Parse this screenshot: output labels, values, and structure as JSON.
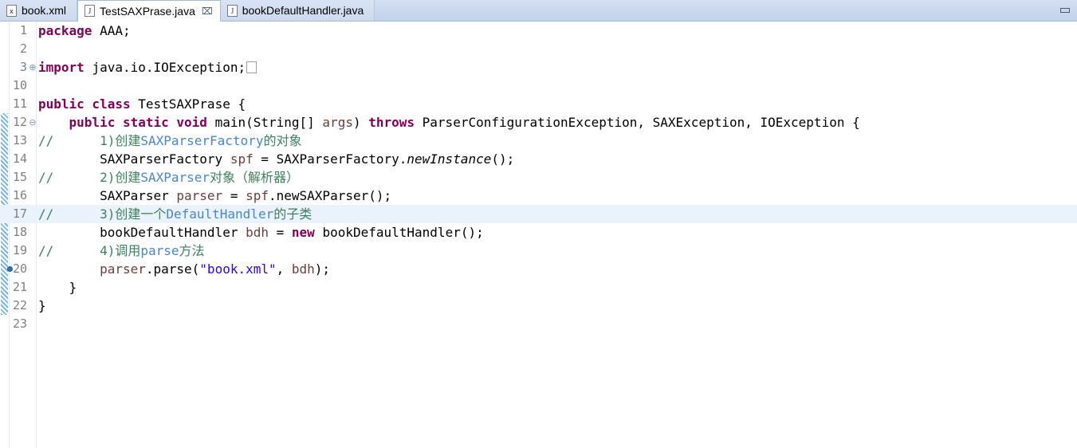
{
  "window": {
    "minimize_label": "Minimize"
  },
  "tabs": [
    {
      "label": "book.xml",
      "icon": "xml-file-icon",
      "active": false,
      "closable": false
    },
    {
      "label": "TestSAXPrase.java",
      "icon": "java-file-icon",
      "active": true,
      "closable": true,
      "close_glyph": "⌧"
    },
    {
      "label": "bookDefaultHandler.java",
      "icon": "java-file-icon",
      "active": false,
      "closable": false
    }
  ],
  "editor": {
    "file": "TestSAXPrase.java",
    "current_line": 17,
    "marker_line": 20,
    "lines": [
      {
        "num": "1",
        "fold": "",
        "segments": [
          {
            "t": "package ",
            "c": "kw"
          },
          {
            "t": "AAA;",
            "c": "plain"
          }
        ]
      },
      {
        "num": "2",
        "fold": "",
        "segments": []
      },
      {
        "num": "3",
        "fold": "+",
        "segments": [
          {
            "t": "import ",
            "c": "kw"
          },
          {
            "t": "java.io.IOException;",
            "c": "plain"
          },
          {
            "t": "□",
            "c": "foldbox"
          }
        ]
      },
      {
        "num": "10",
        "fold": "",
        "segments": []
      },
      {
        "num": "11",
        "fold": "",
        "segments": [
          {
            "t": "public class ",
            "c": "kw"
          },
          {
            "t": "TestSAXPrase {",
            "c": "plain"
          }
        ]
      },
      {
        "num": "12",
        "fold": "-",
        "segments": [
          {
            "t": "    ",
            "c": "plain"
          },
          {
            "t": "public static void ",
            "c": "kw"
          },
          {
            "t": "main(String[] ",
            "c": "plain"
          },
          {
            "t": "args",
            "c": "local"
          },
          {
            "t": ") ",
            "c": "plain"
          },
          {
            "t": "throws ",
            "c": "kw"
          },
          {
            "t": "ParserConfigurationException, SAXException, IOException {",
            "c": "plain"
          }
        ]
      },
      {
        "num": "13",
        "fold": "",
        "segments": [
          {
            "t": "//",
            "c": "cmt"
          },
          {
            "t": "      1)创建",
            "c": "cmt"
          },
          {
            "t": "SAXParserFactory",
            "c": "hl-blue"
          },
          {
            "t": "的对象",
            "c": "cmt"
          }
        ]
      },
      {
        "num": "14",
        "fold": "",
        "segments": [
          {
            "t": "        SAXParserFactory ",
            "c": "plain"
          },
          {
            "t": "spf",
            "c": "local"
          },
          {
            "t": " = SAXParserFactory.",
            "c": "plain"
          },
          {
            "t": "newInstance",
            "c": "stat"
          },
          {
            "t": "();",
            "c": "plain"
          }
        ]
      },
      {
        "num": "15",
        "fold": "",
        "segments": [
          {
            "t": "//",
            "c": "cmt"
          },
          {
            "t": "      2)创建",
            "c": "cmt"
          },
          {
            "t": "SAXParser",
            "c": "hl-blue"
          },
          {
            "t": "对象（解析器）",
            "c": "cmt"
          }
        ]
      },
      {
        "num": "16",
        "fold": "",
        "segments": [
          {
            "t": "        SAXParser ",
            "c": "plain"
          },
          {
            "t": "parser",
            "c": "local"
          },
          {
            "t": " = ",
            "c": "plain"
          },
          {
            "t": "spf",
            "c": "local"
          },
          {
            "t": ".newSAXParser();",
            "c": "plain"
          }
        ]
      },
      {
        "num": "17",
        "fold": "",
        "segments": [
          {
            "t": "//",
            "c": "cmt"
          },
          {
            "t": "      3)创建一个",
            "c": "cmt"
          },
          {
            "t": "DefaultHandler",
            "c": "hl-blue"
          },
          {
            "t": "的子类",
            "c": "cmt"
          }
        ]
      },
      {
        "num": "18",
        "fold": "",
        "segments": [
          {
            "t": "        bookDefaultHandler ",
            "c": "plain"
          },
          {
            "t": "bdh",
            "c": "local"
          },
          {
            "t": " = ",
            "c": "plain"
          },
          {
            "t": "new ",
            "c": "kw"
          },
          {
            "t": "bookDefaultHandler();",
            "c": "plain"
          }
        ]
      },
      {
        "num": "19",
        "fold": "",
        "segments": [
          {
            "t": "//",
            "c": "cmt"
          },
          {
            "t": "      4)调用",
            "c": "cmt"
          },
          {
            "t": "parse",
            "c": "hl-blue"
          },
          {
            "t": "方法",
            "c": "cmt"
          }
        ]
      },
      {
        "num": "20",
        "fold": "",
        "segments": [
          {
            "t": "        ",
            "c": "plain"
          },
          {
            "t": "parser",
            "c": "local"
          },
          {
            "t": ".parse(",
            "c": "plain"
          },
          {
            "t": "\"book.xml\"",
            "c": "str"
          },
          {
            "t": ", ",
            "c": "plain"
          },
          {
            "t": "bdh",
            "c": "local"
          },
          {
            "t": ");",
            "c": "plain"
          }
        ]
      },
      {
        "num": "21",
        "fold": "",
        "segments": [
          {
            "t": "    }",
            "c": "plain"
          }
        ]
      },
      {
        "num": "22",
        "fold": "",
        "segments": [
          {
            "t": "}",
            "c": "plain"
          }
        ]
      },
      {
        "num": "23",
        "fold": "",
        "segments": []
      }
    ],
    "change_bar": {
      "start_line_index": 5,
      "end_line_index": 15,
      "color": "#7cb6e0"
    }
  },
  "colors": {
    "keyword": "#7f0055",
    "comment": "#3f7f5f",
    "string": "#2a00ff",
    "local_var": "#6a3e3e",
    "comment_link": "#4a86c8",
    "current_line_bg": "#eaf2fc",
    "tab_active_bg": "#ffffff",
    "tab_bar_bg": "#cbd9ee"
  }
}
